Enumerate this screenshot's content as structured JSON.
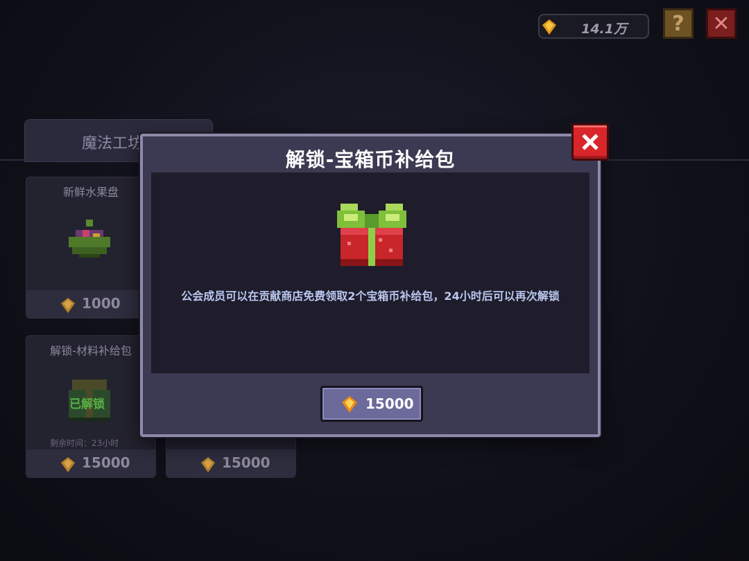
{
  "topbar": {
    "currency_amount": "14.1万",
    "help_label": "?",
    "close_label": "✕"
  },
  "shop": {
    "tab_label": "魔法工坊",
    "items": [
      {
        "title": "新鲜水果盘",
        "price": "1000"
      },
      {
        "title": "解锁-材料补给包",
        "status": "已解锁",
        "remaining": "剩余时间：23小时",
        "price": "15000"
      },
      {
        "price": "15000"
      }
    ]
  },
  "modal": {
    "title": "解锁-宝箱币补给包",
    "description": "公会成员可以在贡献商店免费领取2个宝箱币补给包，24小时后可以再次解锁",
    "price": "15000"
  },
  "colors": {
    "modal_frame": "#8e8aa8",
    "modal_bg": "#3c3a52",
    "body_bg": "#1f1d2b",
    "close_red": "#d8262a",
    "button_purple": "#6b6a9a",
    "desc_text": "#b9c7ef",
    "gem_gold": "#f0a61a"
  },
  "icons": [
    "gem-icon",
    "help-icon",
    "close-icon",
    "gift-box-icon",
    "fruit-plate-icon",
    "material-pack-icon"
  ]
}
